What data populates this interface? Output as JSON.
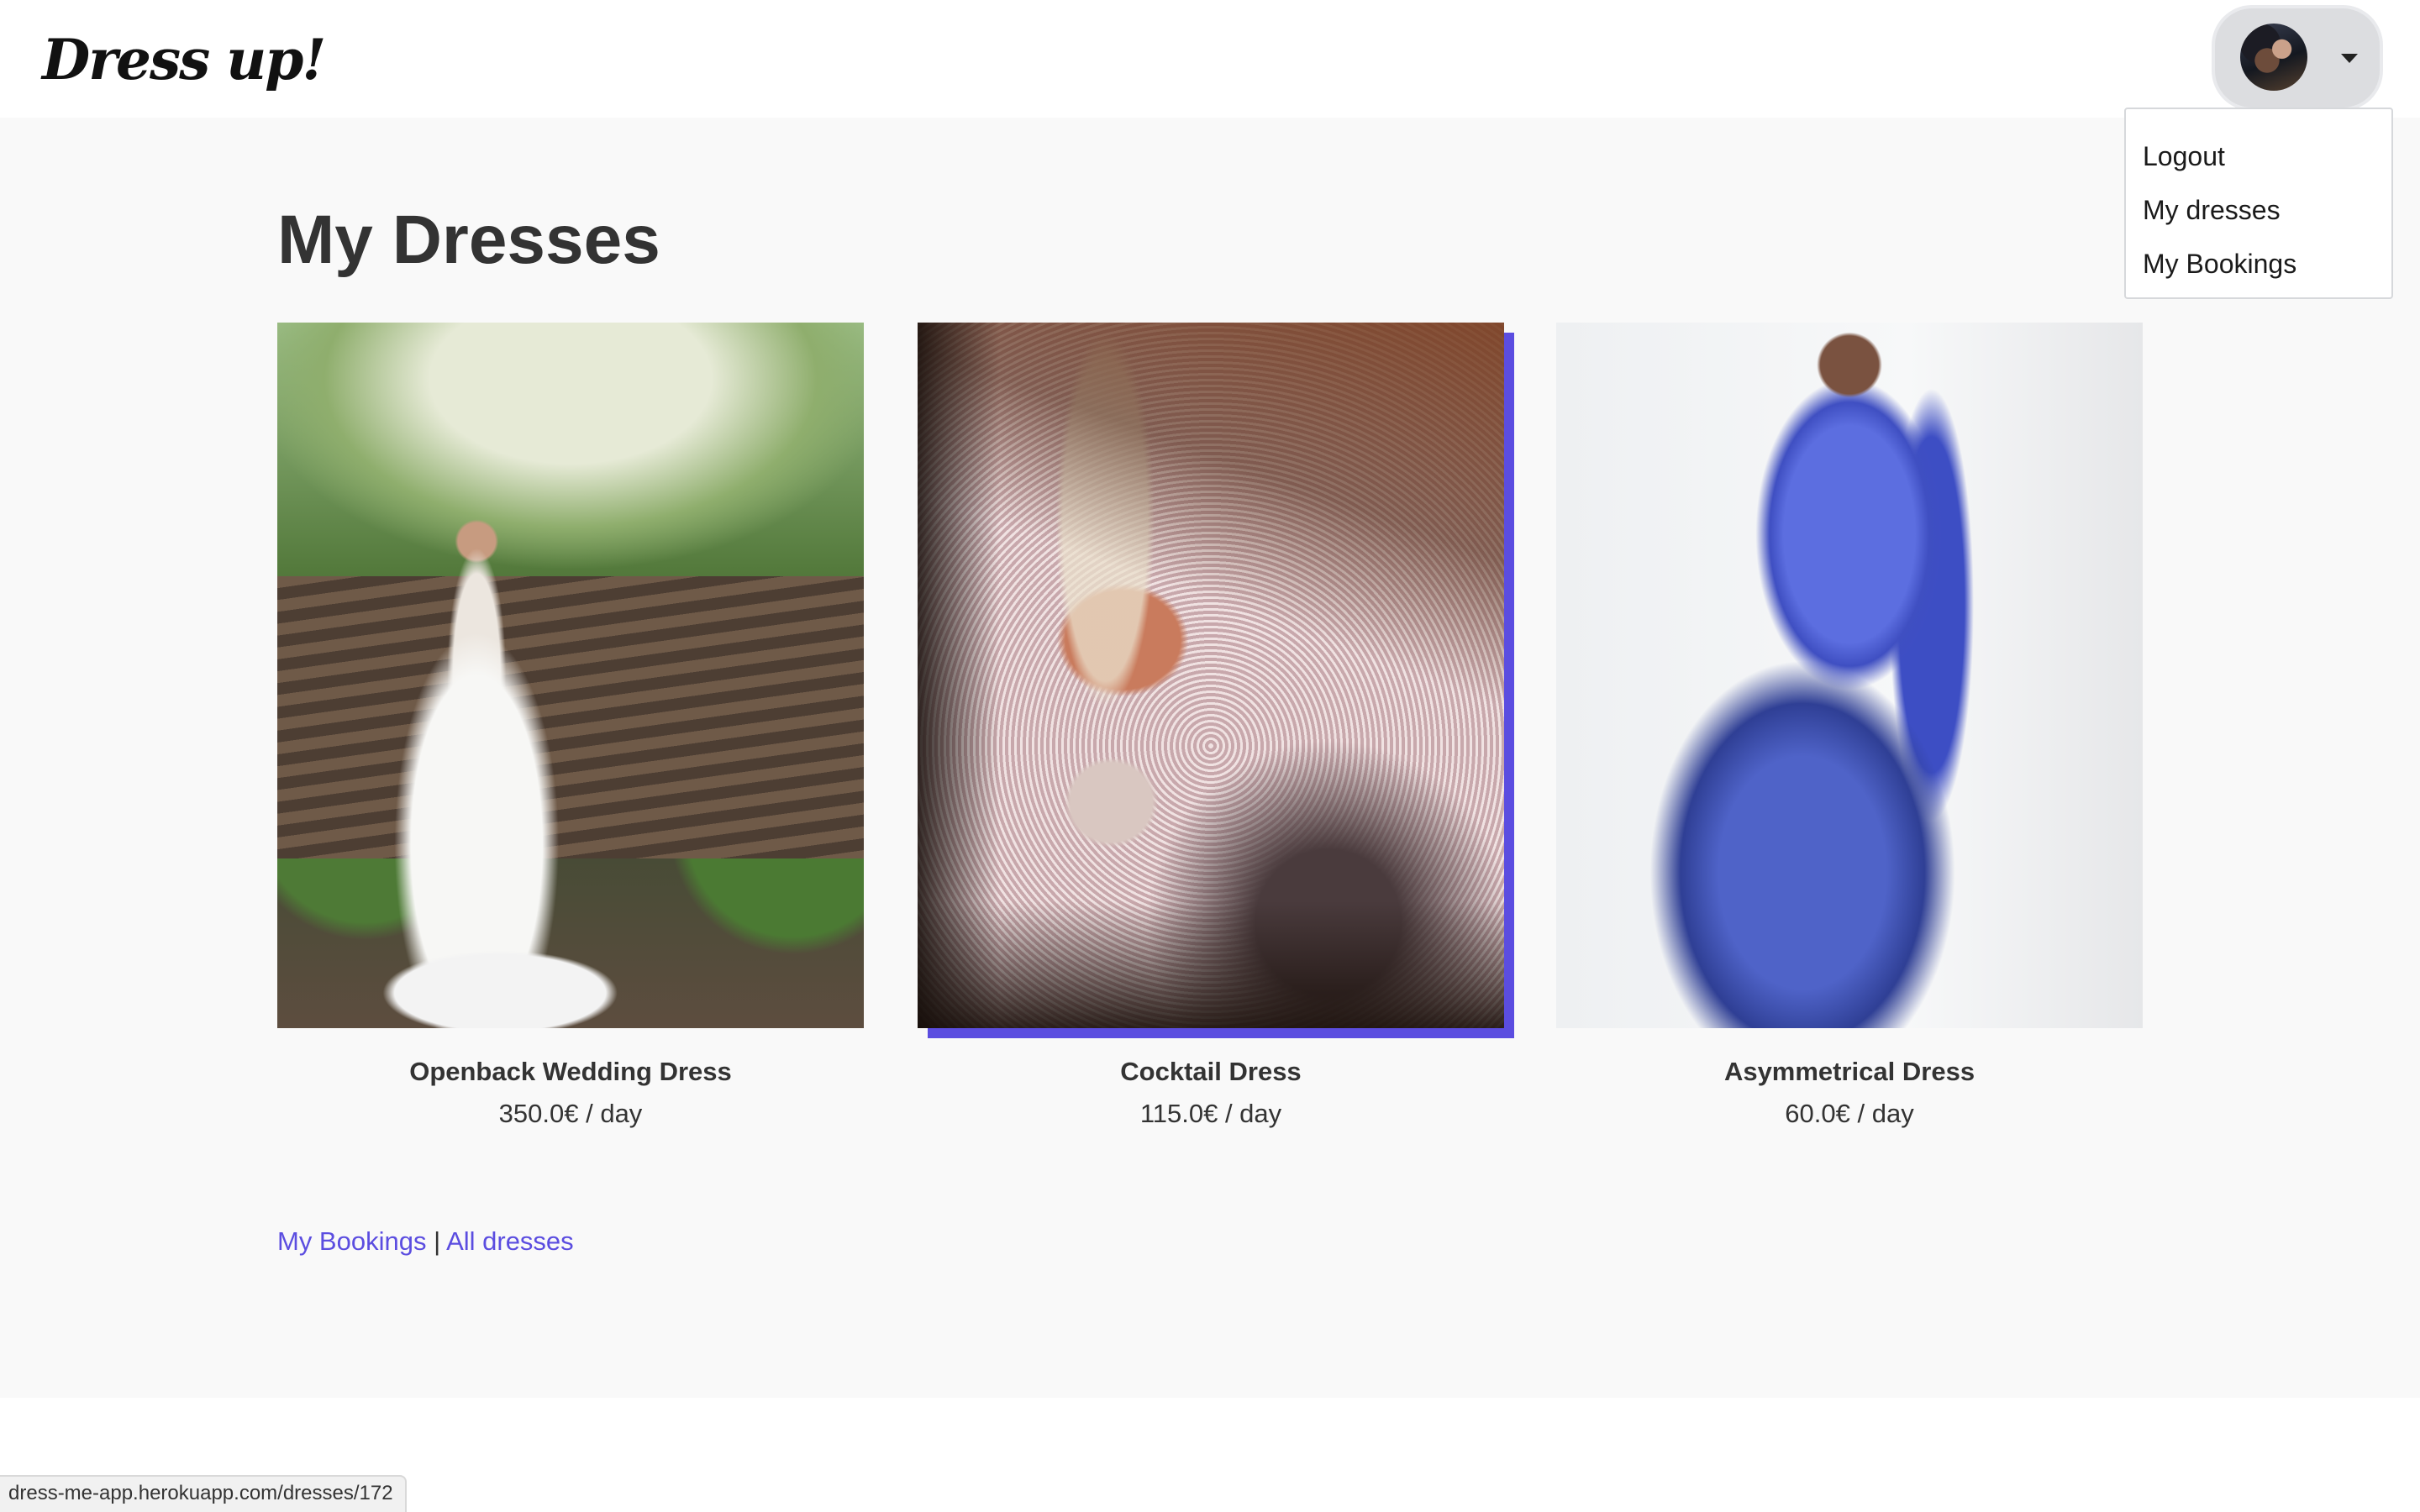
{
  "navbar": {
    "brand": "Dress up!",
    "avatar_icon": "user-avatar"
  },
  "dropdown": {
    "items": [
      {
        "label": "Logout"
      },
      {
        "label": "My dresses"
      },
      {
        "label": "My Bookings"
      }
    ]
  },
  "page": {
    "title": "My Dresses"
  },
  "dresses": [
    {
      "name": "Openback Wedding Dress",
      "price": "350.0€ / day"
    },
    {
      "name": "Cocktail Dress",
      "price": "115.0€ / day"
    },
    {
      "name": "Asymmetrical Dress",
      "price": "60.0€ / day"
    }
  ],
  "footer": {
    "bookings_link": "My Bookings",
    "separator": "|",
    "all_dresses_link": "All dresses"
  },
  "status_bar": {
    "url": "dress-me-app.herokuapp.com/dresses/172"
  },
  "colors": {
    "accent": "#5b4de0",
    "page_background": "#f9f9f9",
    "navbar_background": "#ffffff"
  }
}
